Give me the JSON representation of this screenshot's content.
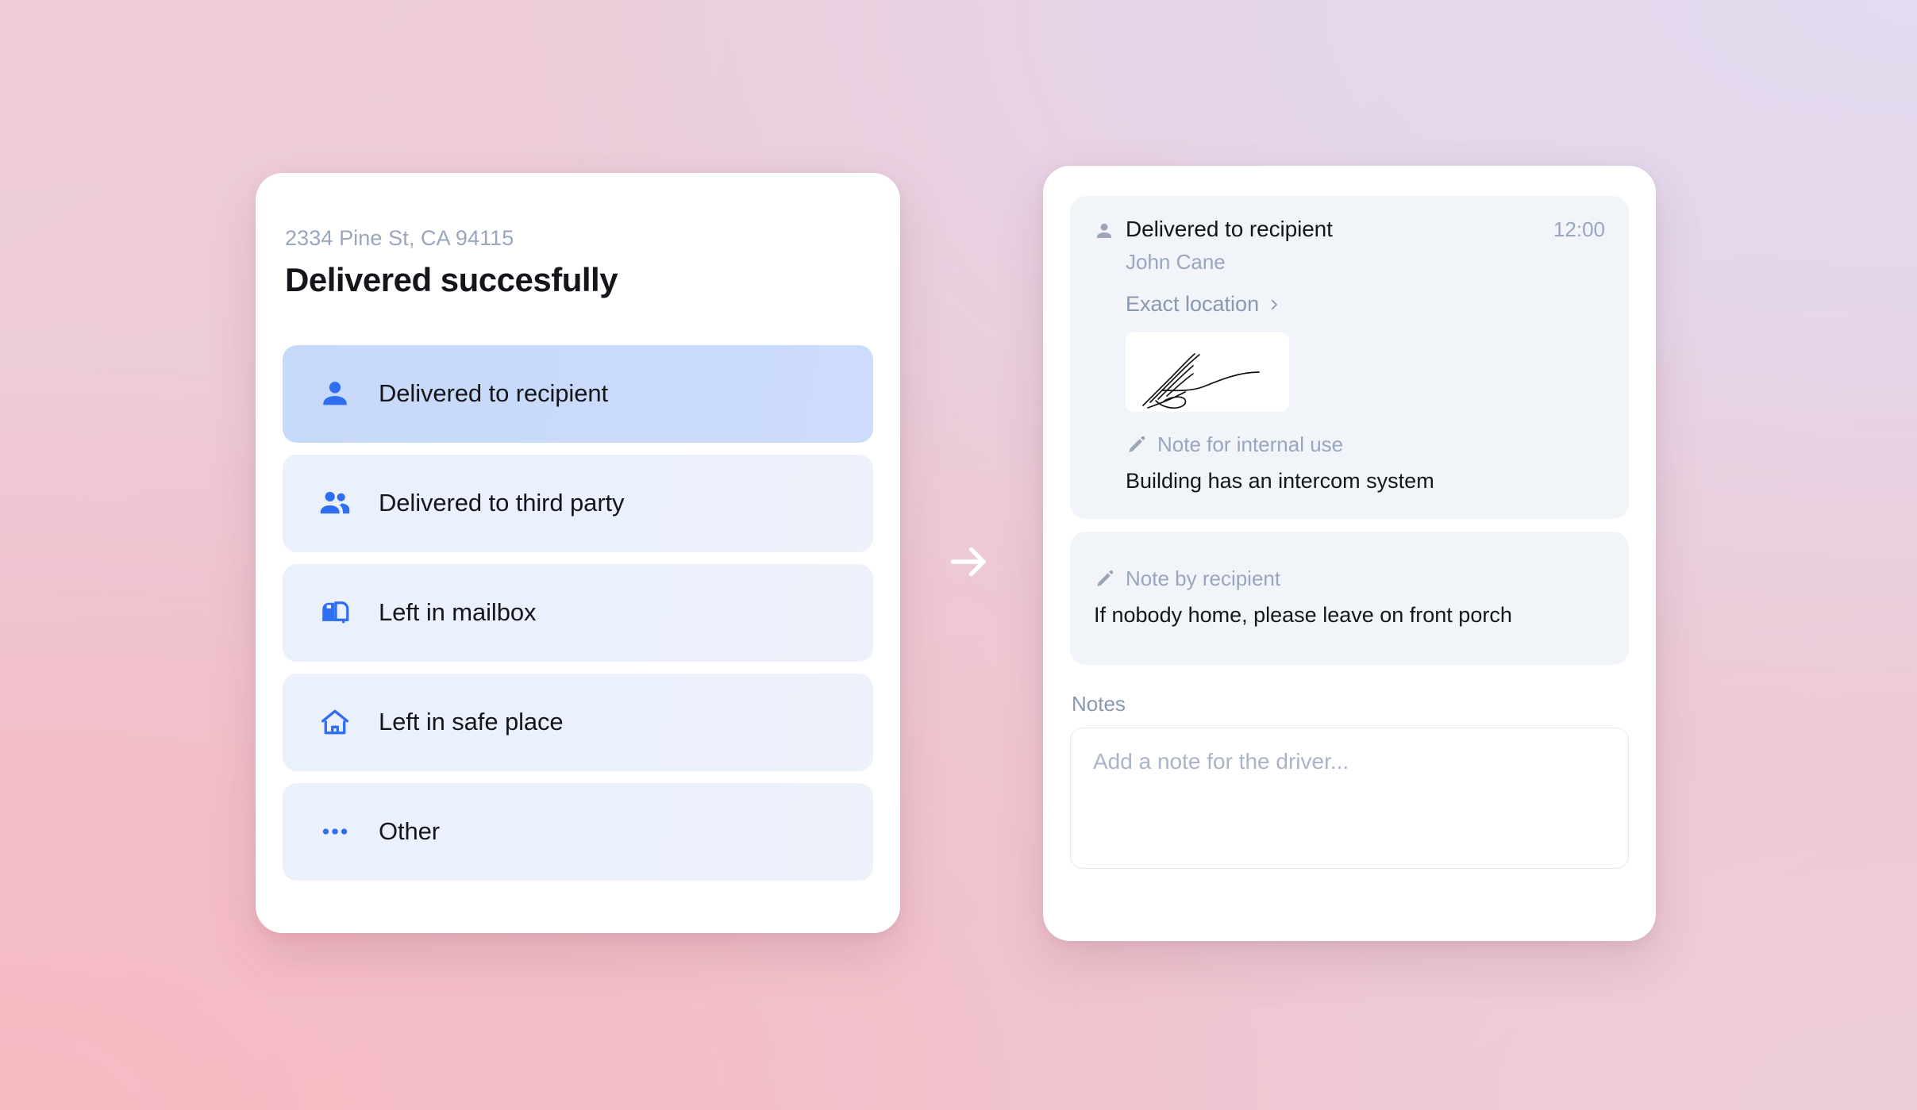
{
  "background": {
    "top_left_color": "#eecdd9",
    "top_right_color": "#e3dbf0",
    "bottom_left_color": "#f6bac2",
    "bottom_right_color": "#edcdda"
  },
  "theme": {
    "accent_blue": "#2f6ef0",
    "selected_row_bg": "#c7d9f9",
    "row_bg": "#eaf0fc",
    "panel_bg": "#f1f4f8",
    "muted_text": "#9aa6bd",
    "primary_text": "#14161c",
    "card_bg": "#ffffff"
  },
  "left_card": {
    "address": "2334 Pine St, CA 94115",
    "title": "Delivered succesfully",
    "options": [
      {
        "label": "Delivered to recipient",
        "icon": "person-icon",
        "selected": true
      },
      {
        "label": "Delivered to third party",
        "icon": "people-icon",
        "selected": false
      },
      {
        "label": "Left in mailbox",
        "icon": "mailbox-icon",
        "selected": false
      },
      {
        "label": "Left in safe place",
        "icon": "home-icon",
        "selected": false
      },
      {
        "label": "Other",
        "icon": "ellipsis-icon",
        "selected": false
      }
    ]
  },
  "flow": {
    "arrow_icon": "arrow-right-icon"
  },
  "right_card": {
    "delivery_panel": {
      "status_icon": "person-icon",
      "status_title": "Delivered to recipient",
      "time": "12:00",
      "recipient_name": "John Cane",
      "exact_location_label": "Exact location",
      "exact_location_chevron": "chevron-right-icon",
      "signature_alt": "signature-image",
      "internal_note": {
        "icon": "pencil-icon",
        "label": "Note for internal use",
        "value": "Building has an intercom system"
      }
    },
    "recipient_note_panel": {
      "icon": "pencil-icon",
      "label": "Note by recipient",
      "value": "If nobody home, please leave on front porch"
    },
    "notes_section": {
      "caption": "Notes",
      "placeholder": "Add a note for the driver...",
      "value": ""
    }
  }
}
